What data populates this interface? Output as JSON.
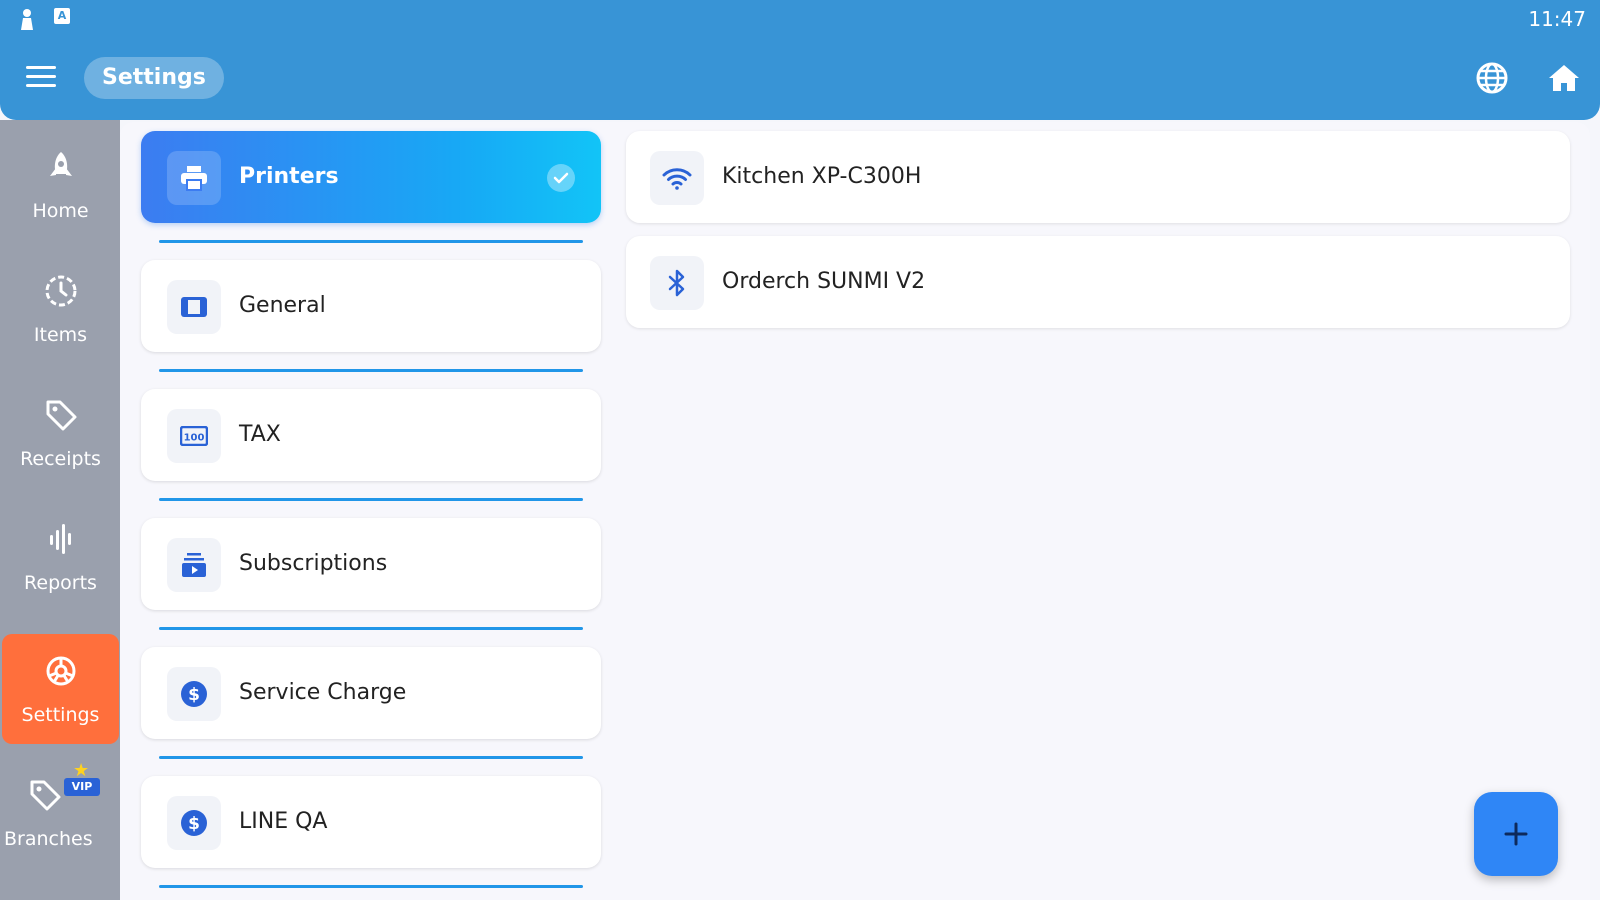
{
  "status_bar": {
    "time": "11:47",
    "keyboard_icon_text": "A"
  },
  "header": {
    "title": "Settings",
    "icons": [
      "menu-icon",
      "globe-icon",
      "home-icon"
    ]
  },
  "sidebar": {
    "items": [
      {
        "label": "Home",
        "icon": "rocket-icon"
      },
      {
        "label": "Items",
        "icon": "clock-icon"
      },
      {
        "label": "Receipts",
        "icon": "tag-icon"
      },
      {
        "label": "Reports",
        "icon": "equalizer-icon"
      },
      {
        "label": "Settings",
        "icon": "gear-icon",
        "active": true
      },
      {
        "label": "Branches",
        "icon": "tag-icon",
        "badge": "VIP"
      }
    ]
  },
  "categories": [
    {
      "label": "Printers",
      "icon": "printer-icon",
      "active": true
    },
    {
      "label": "General",
      "icon": "columns-icon"
    },
    {
      "label": "TAX",
      "icon": "ticket-icon"
    },
    {
      "label": "Subscriptions",
      "icon": "subscriptions-icon"
    },
    {
      "label": "Service Charge",
      "icon": "dollar-icon"
    },
    {
      "label": "LINE QA",
      "icon": "dollar-icon"
    }
  ],
  "printers": [
    {
      "name": "Kitchen XP-C300H",
      "connection": "wifi-icon"
    },
    {
      "name": "Orderch SUNMI V2",
      "connection": "bluetooth-icon"
    }
  ],
  "fab": {
    "icon": "plus-icon"
  },
  "colors": {
    "header": "#3894d6",
    "sidebar": "#9aa0ad",
    "active_nav": "#ff6f3c",
    "accent": "#2f86f6"
  }
}
